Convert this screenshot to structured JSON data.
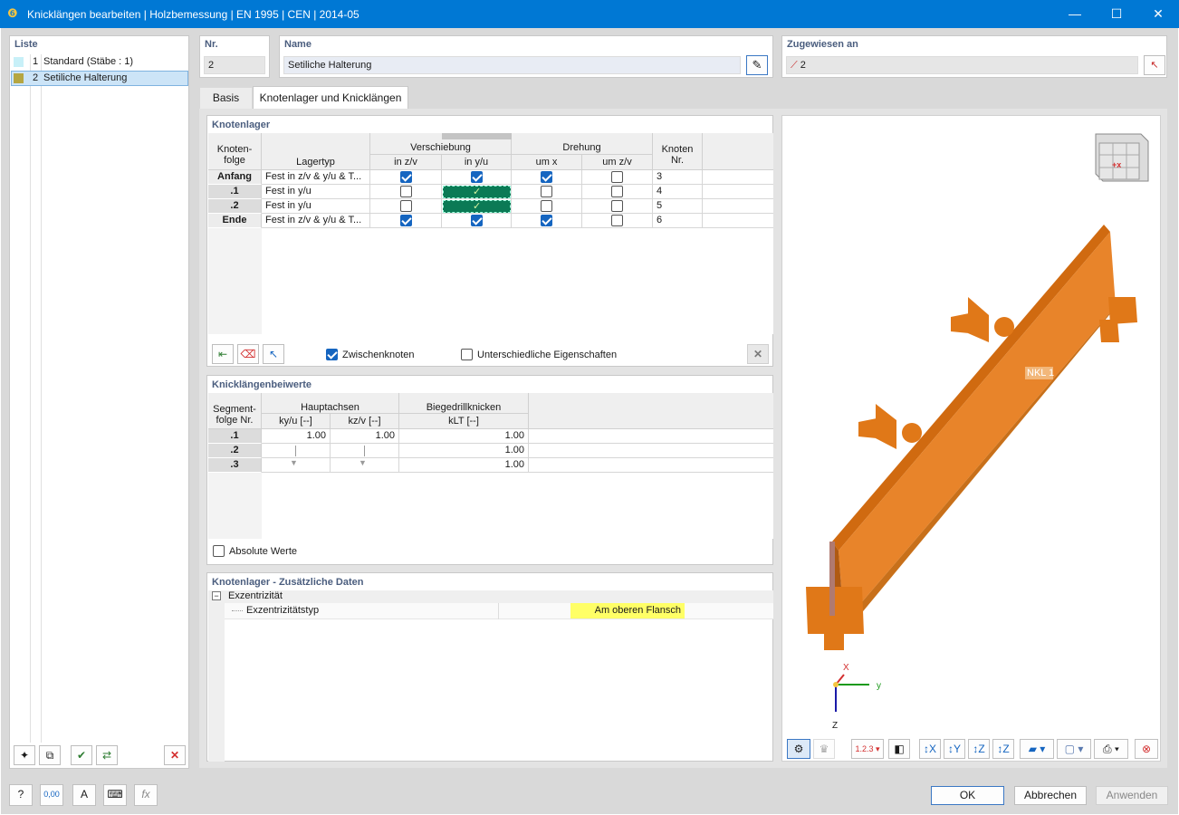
{
  "window": {
    "title": "Knicklängen bearbeiten | Holzbemessung | EN 1995 | CEN | 2014-05",
    "minimize": "—",
    "maximize": "☐",
    "close": "✕"
  },
  "list": {
    "header": "Liste",
    "items": [
      {
        "num": "1",
        "label": "Standard (Stäbe : 1)",
        "color": "#c8f0f8"
      },
      {
        "num": "2",
        "label": "Setiliche Halterung",
        "color": "#b5a642"
      }
    ]
  },
  "nr": {
    "label": "Nr.",
    "value": "2"
  },
  "name": {
    "label": "Name",
    "value": "Setiliche Halterung"
  },
  "assigned": {
    "label": "Zugewiesen an",
    "value": "2"
  },
  "tabs": [
    "Basis",
    "Knotenlager und Knicklängen"
  ],
  "nodal": {
    "title": "Knotenlager",
    "col_seq": "Knoten-\nfolge",
    "col_type": "Lagertyp",
    "grp_shift": "Verschiebung",
    "grp_rot": "Drehung",
    "sub_zv": "in z/v",
    "sub_yu": "in y/u",
    "sub_umx": "um x",
    "sub_umzv": "um z/v",
    "col_node": "Knoten\nNr.",
    "rows": [
      {
        "seq": "Anfang",
        "type": "Fest in z/v & y/u & T...",
        "zv": true,
        "yu": true,
        "umx": true,
        "umzv": false,
        "node": "3"
      },
      {
        "seq": ".1",
        "type": "Fest in y/u",
        "zv": false,
        "yu": true,
        "umx": false,
        "umzv": false,
        "node": "4"
      },
      {
        "seq": ".2",
        "type": "Fest in y/u",
        "zv": false,
        "yu": true,
        "umx": false,
        "umzv": false,
        "node": "5"
      },
      {
        "seq": "Ende",
        "type": "Fest in z/v & y/u & T...",
        "zv": true,
        "yu": true,
        "umx": true,
        "umzv": false,
        "node": "6"
      }
    ],
    "chk_intermediate": "Zwischenknoten",
    "chk_different": "Unterschiedliche Eigenschaften"
  },
  "coef": {
    "title": "Knicklängenbeiwerte",
    "col_seq": "Segment-\nfolge Nr.",
    "grp_main": "Hauptachsen",
    "grp_ltb": "Biegedrillknicken",
    "sub_ky": "ky/u [--]",
    "sub_kz": "kz/v [--]",
    "sub_klt": "kLT [--]",
    "rows": [
      {
        "seq": ".1",
        "ky": "1.00",
        "kz": "1.00",
        "klt": "1.00"
      },
      {
        "seq": ".2",
        "ky": "",
        "kz": "",
        "klt": "1.00"
      },
      {
        "seq": ".3",
        "ky": "",
        "kz": "",
        "klt": "1.00"
      }
    ],
    "chk_abs": "Absolute Werte"
  },
  "extra": {
    "title": "Knotenlager - Zusätzliche Daten",
    "group": "Exzentrizität",
    "prop": "Exzentrizitätstyp",
    "value": "Am oberen Flansch"
  },
  "view": {
    "label_nkl": "NKL 1",
    "axis_x": "X",
    "axis_y": "y",
    "axis_z": "Z",
    "cube_label": "+x"
  },
  "buttons": {
    "ok": "OK",
    "cancel": "Abbrechen",
    "apply": "Anwenden"
  },
  "bottom_icons": [
    "help-icon",
    "units-icon",
    "text-icon",
    "display-icon",
    "formula-icon"
  ]
}
